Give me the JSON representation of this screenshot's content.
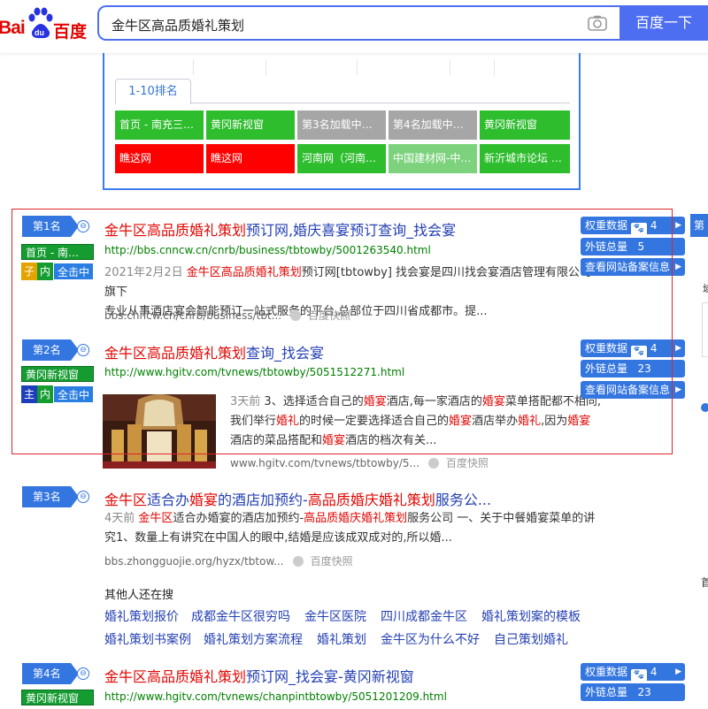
{
  "search": {
    "logo_left": "Bai",
    "logo_paw": "du",
    "logo_right": "百度",
    "query": "金牛区高品质婚礼策划",
    "button": "百度一下"
  },
  "topbox": {
    "tab": "1-10排名",
    "cells_row1": [
      {
        "label": "首页 - 南充三…",
        "color": "#2dbd2d"
      },
      {
        "label": "黄冈新视窗",
        "color": "#2dbd2d"
      },
      {
        "label": "第3名加载中…",
        "color": "#a6a6a6"
      },
      {
        "label": "第4名加载中…",
        "color": "#a6a6a6"
      },
      {
        "label": "黄冈新视窗",
        "color": "#2dbd2d"
      }
    ],
    "cells_row2": [
      {
        "label": "瞧这网",
        "color": "#ff0000"
      },
      {
        "label": "瞧这网",
        "color": "#ff0000"
      },
      {
        "label": "河南网（河南…",
        "color": "#2dbd2d"
      },
      {
        "label": "中国建材网-中…",
        "color": "#7dd27d"
      },
      {
        "label": "新沂城市论坛 …",
        "color": "#2dbd2d"
      }
    ]
  },
  "results": [
    {
      "rank": "第1名",
      "site": "首页 - 南…",
      "tags": [
        "子",
        "内",
        "全击中"
      ],
      "title_hl": "金牛区高品质婚礼策划",
      "title_rest": "预订网,婚庆喜宴预订查询_找会宴",
      "url": "http://bbs.cnncw.cn/cnrb/business/tbtowby/5001263540.html",
      "snip_date": "2021年2月2日",
      "snip_hl": "金牛区高品质婚礼策划",
      "snip_rest1": "预订网[tbtowby] 找会宴是四川找会宴酒店管理有限公司旗下",
      "snip_line2": "专业从事酒店宴会智能预订一站式服务的平台,总部位于四川省成都市。提...",
      "cite": "bbs.cnncw.cn/cnrb/business/tbt...",
      "kuaizhao": "百度快照"
    },
    {
      "rank": "第2名",
      "site": "黄冈新视窗",
      "tags": [
        "主",
        "内",
        "全击中"
      ],
      "title_hl": "金牛区高品质婚礼策划",
      "title_rest": "查询_找会宴",
      "url": "http://www.hgitv.com/tvnews/tbtowby/5051512271.html",
      "snip_date": "3天前",
      "snip_a": "3、选择适合自己的",
      "snip_b": "婚宴",
      "snip_c": "酒店,每一家酒店的",
      "snip_d": "婚宴",
      "snip_e": "菜单搭配都不相同,",
      "snip_f": "我们举行",
      "snip_g": "婚礼",
      "snip_h": "的时候一定要选择适合自己的",
      "snip_i": "婚宴",
      "snip_j": "酒店举办",
      "snip_k": "婚礼",
      "snip_l": ",因为",
      "snip_m": "婚宴",
      "snip_n": "酒店的菜品搭配和",
      "snip_o": "婚宴",
      "snip_p": "酒店的档次有关...",
      "cite": "www.hgitv.com/tvnews/tbtowby/5...",
      "kuaizhao": "百度快照"
    },
    {
      "rank": "第3名",
      "title_a": "金牛区",
      "title_b": "适合办",
      "title_c": "婚宴",
      "title_d": "的酒店加预约-",
      "title_e": "高品质婚庆婚礼策划",
      "title_f": "服务公...",
      "snip_date": "4天前",
      "snip_a": "金牛区",
      "snip_b": "适合办婚宴的酒店加预约-",
      "snip_c": "高品质婚庆婚礼策划",
      "snip_d": "服务公司 一、关于中餐婚宴菜单的讲",
      "snip_line2": "究1、数量上有讲究在中国人的眼中,结婚是应该成双成对的,所以婚...",
      "cite": "bbs.zhongguojie.org/hyzx/tbtow...",
      "kuaizhao": "百度快照"
    },
    {
      "rank": "第4名",
      "site": "黄冈新视窗",
      "title_hl": "金牛区高品质婚礼策划",
      "title_rest": "预订网_找会宴-黄冈新视窗",
      "url": "http://www.hgitv.com/tvnews/chanpintbtowby/5051201209.html"
    }
  ],
  "seo": {
    "weight_label": "权重数据",
    "weight_val": "4",
    "links_label": "外链总量",
    "links_r1": "5",
    "links_r2": "23",
    "links_r4": "23",
    "record_label": "查看网站备案信息"
  },
  "related": {
    "title": "其他人还在搜",
    "row1": [
      "婚礼策划报价",
      "成都金牛区很穷吗",
      "金牛区医院",
      "四川成都金牛区",
      "婚礼策划案的模板"
    ],
    "row2": [
      "婚礼策划书案例",
      "婚礼策划方案流程",
      "婚礼策划",
      "金牛区为什么不好",
      "自己策划婚礼"
    ]
  },
  "side": {
    "top": "第",
    "mid": "域",
    "low": "首"
  }
}
